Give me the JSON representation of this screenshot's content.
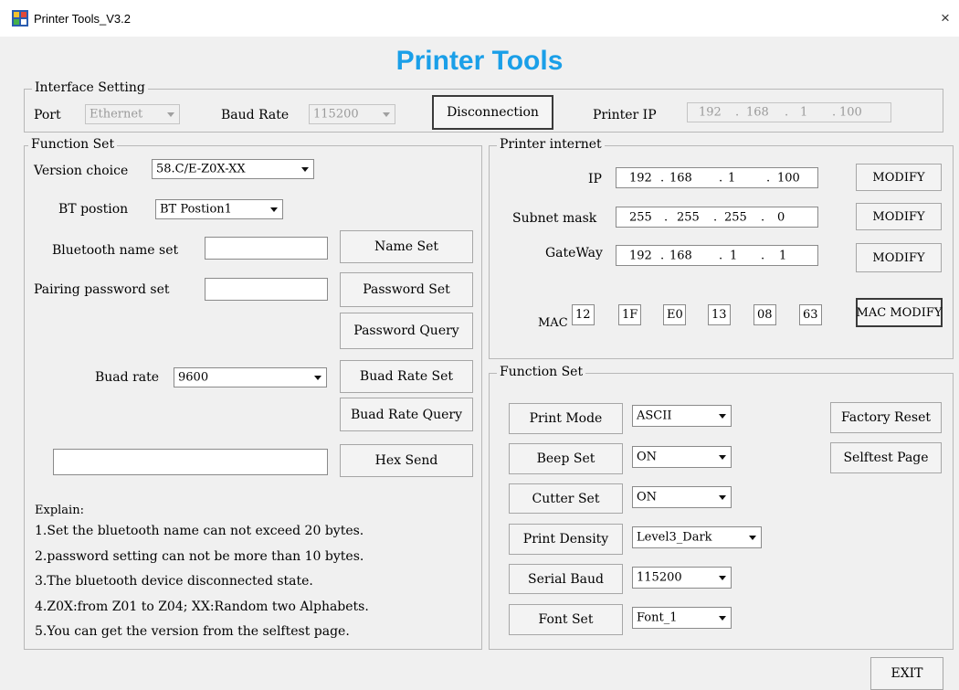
{
  "window": {
    "title": "Printer Tools_V3.2",
    "close": "×"
  },
  "heading": "Printer Tools",
  "interface": {
    "legend": "Interface Setting",
    "port_label": "Port",
    "port_value": "Ethernet",
    "baud_label": "Baud Rate",
    "baud_value": "115200",
    "disconnect": "Disconnection",
    "ip_label": "Printer IP",
    "ip": [
      "192",
      "168",
      "1",
      "100"
    ]
  },
  "function_left": {
    "legend": "Function Set",
    "version_label": "Version choice",
    "version_value": "58.C/E-Z0X-XX",
    "bt_label": "BT postion",
    "bt_value": "BT Postion1",
    "btname_label": "Bluetooth name set",
    "name_set": "Name Set",
    "pair_label": "Pairing password set",
    "password_set": "Password Set",
    "password_query": "Password Query",
    "buad_label": "Buad rate",
    "buad_value": "9600",
    "buad_set": "Buad Rate Set",
    "buad_query": "Buad Rate Query",
    "hex_send": "Hex Send",
    "explain_title": "Explain:",
    "explain": [
      "1.Set the bluetooth name can not exceed 20 bytes.",
      "2.password setting can not be more than 10 bytes.",
      "3.The bluetooth device disconnected state.",
      "4.Z0X:from Z01 to Z04; XX:Random two Alphabets.",
      "5.You can get the version from the selftest page."
    ]
  },
  "internet": {
    "legend": "Printer internet",
    "ip_label": "IP",
    "ip": [
      "192",
      "168",
      "1",
      "100"
    ],
    "mask_label": "Subnet mask",
    "mask": [
      "255",
      "255",
      "255",
      "0"
    ],
    "gw_label": "GateWay",
    "gw": [
      "192",
      "168",
      "1",
      "1"
    ],
    "modify": "MODIFY",
    "mac_label": "MAC",
    "mac": [
      "12",
      "1F",
      "E0",
      "13",
      "08",
      "63"
    ],
    "mac_modify": "MAC MODIFY"
  },
  "function_right": {
    "legend": "Function Set",
    "print_mode": "Print Mode",
    "print_mode_value": "ASCII",
    "beep": "Beep Set",
    "beep_value": "ON",
    "cutter": "Cutter Set",
    "cutter_value": "ON",
    "density": "Print Density",
    "density_value": "Level3_Dark",
    "serial": "Serial Baud",
    "serial_value": "115200",
    "font": "Font Set",
    "font_value": "Font_1",
    "factory_reset": "Factory Reset",
    "selftest": "Selftest Page"
  },
  "exit": "EXIT"
}
